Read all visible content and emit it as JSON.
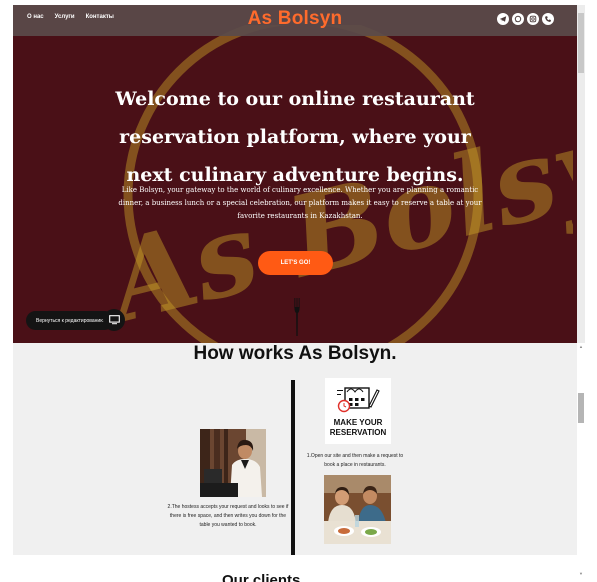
{
  "header": {
    "nav": [
      "О нас",
      "Услуги",
      "Контакты"
    ],
    "logo": "As Bolsyn",
    "socials": [
      "telegram-icon",
      "whatsapp-icon",
      "instagram-icon",
      "phone-icon"
    ]
  },
  "hero": {
    "title": "Welcome to our online restaurant reservation platform, where your next culinary adventure begins.",
    "text": "Like Bolsyn, your gateway to the world of culinary excellence. Whether you are planning a romantic dinner, a business lunch or a special celebration, our platform makes it easy to reserve a table at your favorite restaurants in Kazakhstan.",
    "cta": "LET'S GO!",
    "back_to_edit": "Вернуться к редактированию",
    "watermark": "As Bolsyn!"
  },
  "how": {
    "title": "How works As Bolsyn.",
    "reserve_label": "MAKE YOUR RESERVATION",
    "step1": "1.Open our site and then make a request to book a place in restaurants.",
    "step2": "2.The hostess accepts your request and looks to see if there is free space, and then writes you down for the table you wanted to book."
  },
  "next_section_peek": "Our clients",
  "colors": {
    "hero_bg": "#4a1017",
    "accent": "#ff5a14",
    "logo": "#ff6b2c",
    "watermark": "#c9a227"
  }
}
